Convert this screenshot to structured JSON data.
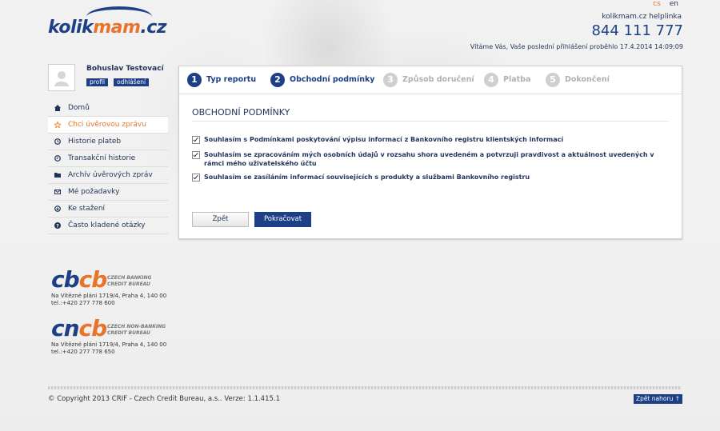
{
  "header": {
    "logo_main": "kolik",
    "logo_accent": "mam",
    "logo_tld": ".cz",
    "lang_cs": "cs",
    "lang_en": "en",
    "helpline_label": "kolikmam.cz helplinka",
    "helpline_number": "844 111 777",
    "welcome": "Vítáme Vás, Vaše poslední přihlášení proběhlo 17.4.2014 14:09:09"
  },
  "user": {
    "name": "Bohuslav Testovací",
    "profile_label": "profil",
    "logout_label": "odhlášení"
  },
  "sidebar": {
    "items": [
      {
        "label": "Domů",
        "icon": "home-icon"
      },
      {
        "label": "Chci úvěrovou zprávu",
        "icon": "star-icon"
      },
      {
        "label": "Historie plateb",
        "icon": "clock-icon"
      },
      {
        "label": "Transakční historie",
        "icon": "history-icon"
      },
      {
        "label": "Archív úvěrových zpráv",
        "icon": "folder-icon"
      },
      {
        "label": "Mé požadavky",
        "icon": "mail-icon"
      },
      {
        "label": "Ke stažení",
        "icon": "download-icon"
      },
      {
        "label": "Často kladené otázky",
        "icon": "question-icon"
      }
    ],
    "active_index": 1
  },
  "bureaus": [
    {
      "letters_a": "cb",
      "letters_b": "cb",
      "desc_1": "CZECH BANKING",
      "desc_2": "CREDIT BUREAU",
      "address": "Na Vítězné pláni 1719/4, Praha 4, 140 00",
      "phone": "tel.:+420 277 778 600"
    },
    {
      "letters_a": "cn",
      "letters_b": "cb",
      "desc_1": "CZECH NON-BANKING",
      "desc_2": "CREDIT BUREAU",
      "address": "Na Vítězné pláni 1719/4, Praha 4, 140 00",
      "phone": "tel.:+420 277 778 650"
    }
  ],
  "steps": [
    {
      "num": "1",
      "label": "Typ reportu",
      "state": "done"
    },
    {
      "num": "2",
      "label": "Obchodní podmínky",
      "state": "done"
    },
    {
      "num": "3",
      "label": "Způsob doručení",
      "state": "todo"
    },
    {
      "num": "4",
      "label": "Platba",
      "state": "todo"
    },
    {
      "num": "5",
      "label": "Dokončení",
      "state": "todo"
    }
  ],
  "main": {
    "title": "OBCHODNÍ PODMÍNKY",
    "checkboxes": [
      {
        "label": "Souhlasím s Podmínkami poskytování výpisu informací z Bankovního registru klientských informací",
        "checked": true
      },
      {
        "label": "Souhlasím se zpracováním mých osobních údajů v rozsahu shora uvedeném a potvrzuji pravdivost a aktuálnost uvedených v rámci mého uživatelského účtu",
        "checked": true
      },
      {
        "label": "Souhlasím se zasíláním informací souvisejících s produkty a službami Bankovního registru",
        "checked": true
      }
    ],
    "back_label": "Zpět",
    "continue_label": "Pokračovat"
  },
  "footer": {
    "copyright": "© Copyright 2013 CRIF - Czech Credit Bureau, a.s.. Verze: 1.1.415.1",
    "top_label": "Zpět nahoru ↑"
  },
  "colors": {
    "brand_blue": "#1d3f86",
    "accent_orange": "#e8742a"
  }
}
